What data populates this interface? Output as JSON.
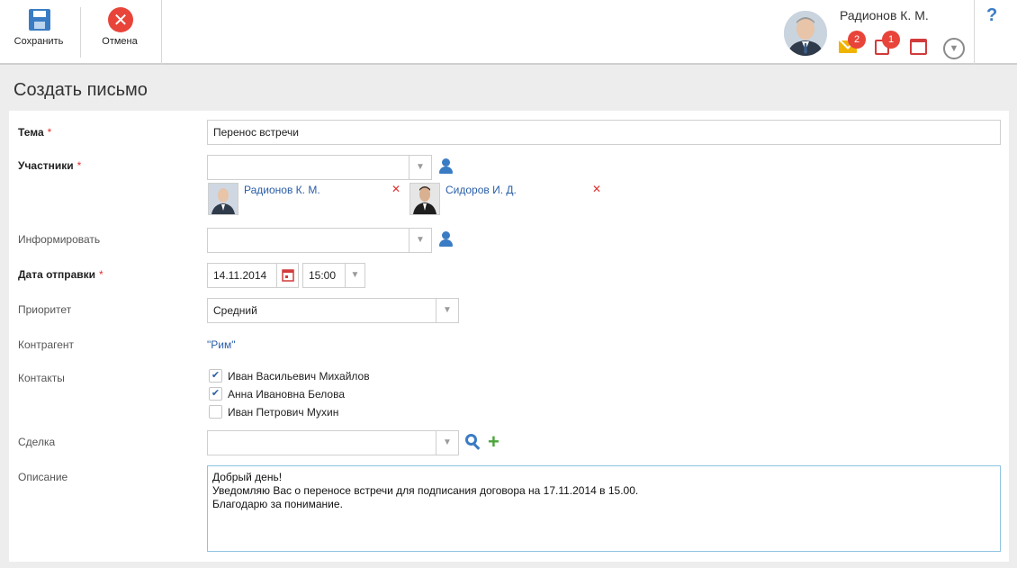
{
  "toolbar": {
    "save_label": "Сохранить",
    "cancel_label": "Отмена"
  },
  "user": {
    "name": "Радионов К. М.",
    "mail_count": "2",
    "tasks_count": "1"
  },
  "help_label": "?",
  "page": {
    "title": "Создать письмо"
  },
  "form": {
    "subject": {
      "label": "Тема",
      "value": "Перенос встречи",
      "required": "*"
    },
    "participants": {
      "label": "Участники",
      "required": "*",
      "items": [
        {
          "name": "Радионов К. М."
        },
        {
          "name": "Сидоров И. Д."
        }
      ]
    },
    "inform": {
      "label": "Информировать"
    },
    "send_date": {
      "label": "Дата отправки",
      "required": "*",
      "date": "14.11.2014",
      "time": "15:00"
    },
    "priority": {
      "label": "Приоритет",
      "value": "Средний"
    },
    "counterparty": {
      "label": "Контрагент",
      "value": "\"Рим\""
    },
    "contacts": {
      "label": "Контакты",
      "items": [
        {
          "name": "Иван Васильевич Михайлов",
          "checked": true
        },
        {
          "name": "Анна Ивановна Белова",
          "checked": true
        },
        {
          "name": "Иван Петрович Мухин",
          "checked": false
        }
      ]
    },
    "deal": {
      "label": "Сделка"
    },
    "description": {
      "label": "Описание",
      "lines": [
        "Добрый день!",
        "Уведомляю Вас о переносе встречи для подписания договора на 17.11.2014 в 15.00.",
        "Благодарю за понимание."
      ]
    }
  },
  "icons": {
    "save": "floppy-disk-icon",
    "cancel": "close-circle-icon",
    "mail": "envelope-icon",
    "tasks": "task-checklist-icon",
    "calendar": "calendar-icon",
    "expand": "chevron-down-circle-icon",
    "person": "person-icon",
    "search": "search-icon",
    "add": "plus-icon",
    "remove": "close-icon"
  },
  "colors": {
    "accent_blue": "#3a7cc4",
    "link_blue": "#2a5ea8",
    "danger_red": "#e8443a",
    "add_green": "#4aa63a",
    "mail_yellow": "#f0b400"
  }
}
